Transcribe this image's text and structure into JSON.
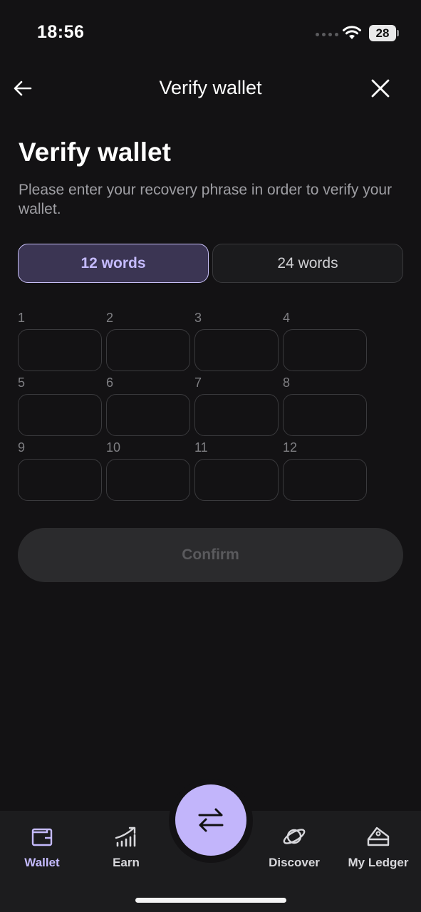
{
  "status_bar": {
    "time": "18:56",
    "battery": "28"
  },
  "header": {
    "title": "Verify wallet"
  },
  "content": {
    "title": "Verify wallet",
    "subtitle": "Please enter your recovery phrase in order to verify your wallet.",
    "toggle": {
      "option_12": "12 words",
      "option_24": "24 words",
      "selected": "12 words"
    },
    "word_numbers": [
      "1",
      "2",
      "3",
      "4",
      "5",
      "6",
      "7",
      "8",
      "9",
      "10",
      "11",
      "12"
    ],
    "confirm_label": "Confirm"
  },
  "bottom_nav": {
    "wallet": "Wallet",
    "earn": "Earn",
    "discover": "Discover",
    "my_ledger": "My Ledger"
  },
  "colors": {
    "accent": "#c2b5fb",
    "background": "#131214",
    "selected_tab_bg": "#3b3553"
  }
}
